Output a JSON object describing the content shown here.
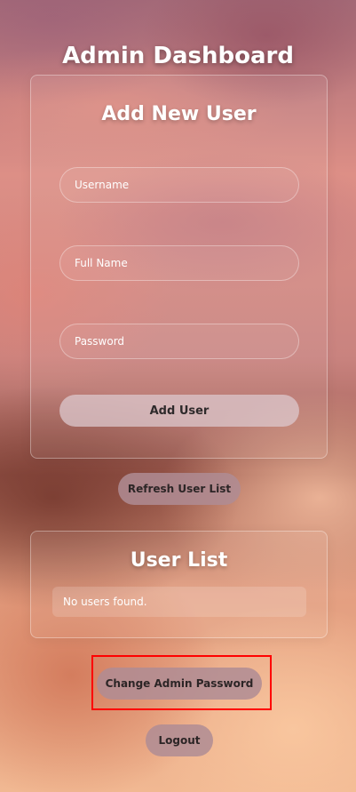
{
  "header": {
    "title": "Admin Dashboard"
  },
  "add_user": {
    "heading": "Add New User",
    "fields": [
      {
        "placeholder": "Username",
        "value": ""
      },
      {
        "placeholder": "Full Name",
        "value": ""
      },
      {
        "placeholder": "Password",
        "value": ""
      }
    ],
    "submit_label": "Add User"
  },
  "actions": {
    "refresh_label": "Refresh User List",
    "change_password_label": "Change Admin Password",
    "logout_label": "Logout"
  },
  "user_list": {
    "heading": "User List",
    "empty_message": "No users found."
  },
  "highlight": {
    "target": "change-admin-password-button",
    "color": "#ff0000"
  },
  "colors": {
    "text": "#ffffff",
    "button_text": "#2c2526"
  }
}
